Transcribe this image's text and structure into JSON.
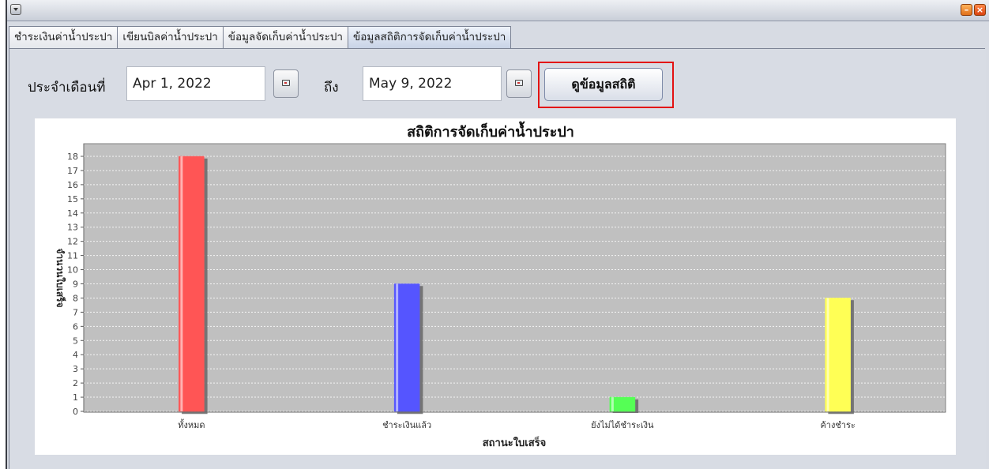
{
  "window": {
    "system_menu_icon": "dropdown-arrow-icon",
    "minimize_icon": "minimize-icon",
    "close_icon": "close-icon"
  },
  "tabs": [
    {
      "label": "ชำระเงินค่าน้ำประปา",
      "active": false
    },
    {
      "label": "เขียนบิลค่าน้ำประปา",
      "active": false
    },
    {
      "label": "ข้อมูลจัดเก็บค่าน้ำประปา",
      "active": false
    },
    {
      "label": "ข้อมูลสถิติการจัดเก็บค่าน้ำประปา",
      "active": true
    }
  ],
  "form": {
    "month_label": "ประจำเดือนที่",
    "from_date": "Apr 1, 2022",
    "to_label": "ถึง",
    "to_date": "May 9, 2022",
    "calendar_icon": "calendar-icon",
    "view_button_label": "ดูข้อมูลสถิติ"
  },
  "chart_data": {
    "type": "bar",
    "title": "สถิติการจัดเก็บค่าน้ำประปา",
    "xlabel": "สถานะใบเสร็จ",
    "ylabel": "จำนวนใบเสร็จ",
    "categories": [
      "ทั้งหมด",
      "ชำระเงินแล้ว",
      "ยังไม่ได้ชำระเงิน",
      "ค้างชำระ"
    ],
    "values": [
      18,
      9,
      1,
      8
    ],
    "colors": [
      "#ff5555",
      "#5555ff",
      "#55ff55",
      "#ffff55"
    ],
    "ylim": [
      0,
      18
    ],
    "yticks": [
      0,
      1,
      2,
      3,
      4,
      5,
      6,
      7,
      8,
      9,
      10,
      11,
      12,
      13,
      14,
      15,
      16,
      17,
      18
    ],
    "grid": true,
    "plot_background": "#c0c0c0"
  }
}
